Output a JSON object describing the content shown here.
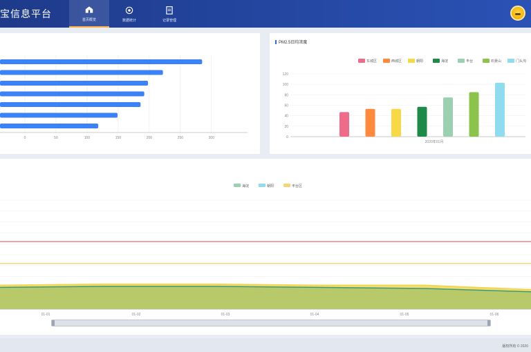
{
  "header": {
    "title": "宝信息平台",
    "nav": [
      {
        "label": "首页概览",
        "icon": "home-icon",
        "active": true
      },
      {
        "label": "数据统计",
        "icon": "gear-icon",
        "active": false
      },
      {
        "label": "记录管理",
        "icon": "document-icon",
        "active": false
      }
    ],
    "avatar_icon": "avatar-icon"
  },
  "colors": {
    "accent": "#2f6bdc",
    "header": "#1e3a8a",
    "bar_blue": "#3b82f6"
  },
  "left_panel": {
    "chart_data": {
      "type": "bar",
      "orientation": "horizontal",
      "categories": [
        "",
        "",
        "",
        "",
        "",
        "",
        ""
      ],
      "values": [
        285,
        222,
        198,
        192,
        186,
        149,
        118
      ],
      "xticks": [
        "0",
        "50",
        "100",
        "150",
        "200",
        "250",
        "300"
      ],
      "xlim": [
        -40,
        358
      ],
      "grid": true
    }
  },
  "right_panel": {
    "title": "PM2.5日均浓度",
    "chart_data": {
      "type": "bar",
      "title": "PM2.5日均浓度",
      "legend_position": "top",
      "series": [
        {
          "name": "东城区",
          "color": "#f06a8a",
          "value": 47
        },
        {
          "name": "西城区",
          "color": "#ff8a3d",
          "value": 53
        },
        {
          "name": "朝阳",
          "color": "#f7d847",
          "value": 53
        },
        {
          "name": "海淀",
          "color": "#1e8a4a",
          "value": 57
        },
        {
          "name": "丰台",
          "color": "#9bd1b0",
          "value": 75
        },
        {
          "name": "石景山",
          "color": "#8cc34a",
          "value": 85
        },
        {
          "name": "门头沟",
          "color": "#8fdcf0",
          "value": 103
        }
      ],
      "yticks": [
        "0",
        "20",
        "40",
        "60",
        "80",
        "100",
        "120"
      ],
      "ylim": [
        0,
        120
      ],
      "xlabel": "2020年01月"
    }
  },
  "bottom_panel": {
    "legend": [
      {
        "name": "海淀",
        "color": "#9bd1b0"
      },
      {
        "name": "朝阳",
        "color": "#8fdcf0"
      },
      {
        "name": "丰台区",
        "color": "#f7d37a"
      }
    ],
    "chart_data": {
      "type": "area",
      "x": [
        "01-01",
        "01-02",
        "01-03",
        "01-04",
        "01-05",
        "01-06"
      ],
      "series": [
        {
          "name": "海淀",
          "values": [
            20,
            21,
            21,
            20,
            19,
            16
          ]
        },
        {
          "name": "朝阳",
          "values": [
            22,
            23,
            23,
            22,
            22,
            18
          ]
        }
      ],
      "reference_lines": [
        {
          "color": "#f08080",
          "value": 62
        },
        {
          "color": "#f7d37a",
          "value": 42
        }
      ],
      "ylim": [
        0,
        100
      ],
      "grid": true
    }
  },
  "footer": {
    "text": "版权所有 © 2020"
  }
}
